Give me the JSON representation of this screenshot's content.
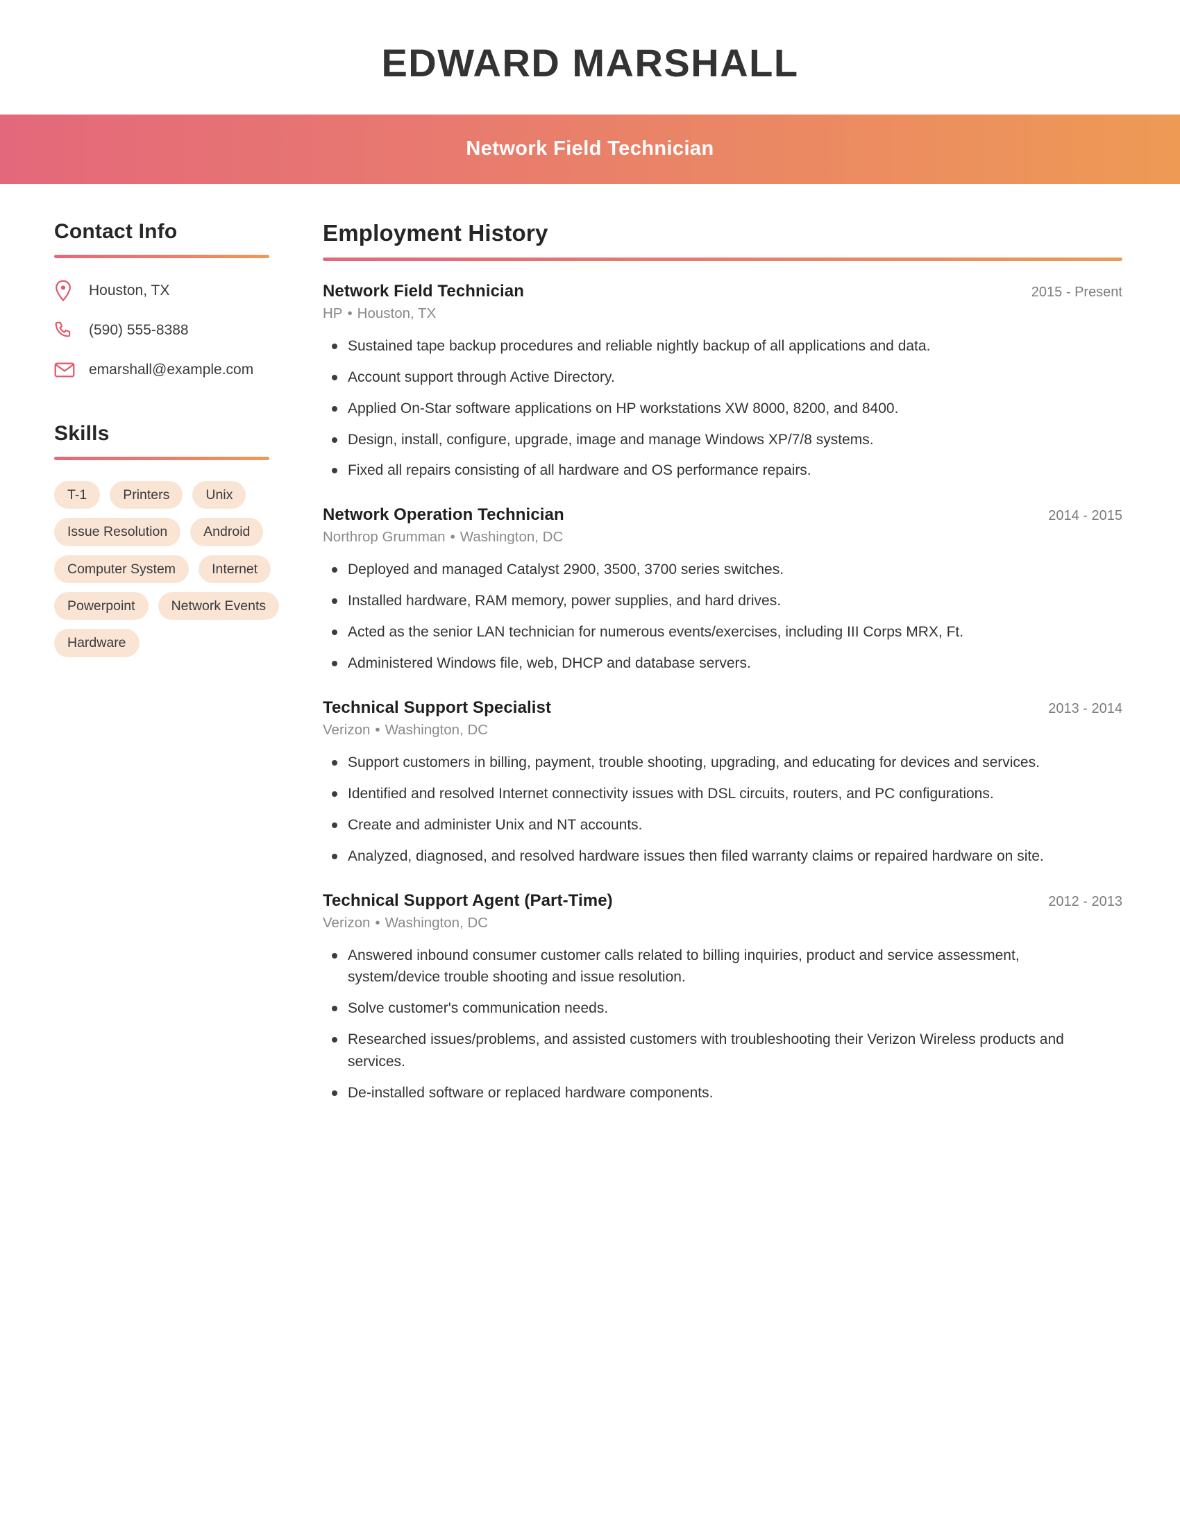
{
  "header": {
    "name": "EDWARD MARSHALL",
    "job_title": "Network Field Technician",
    "gradient_start_color": "#e4687b",
    "gradient_end_color": "#ee9a55"
  },
  "sidebar": {
    "contact": {
      "heading": "Contact Info",
      "items": [
        {
          "icon": "map-pin-icon",
          "value": "Houston, TX"
        },
        {
          "icon": "phone-icon",
          "value": "(590) 555-8388"
        },
        {
          "icon": "envelope-icon",
          "value": "emarshall@example.com"
        }
      ]
    },
    "skills": {
      "heading": "Skills",
      "pill_color": "#fae5d5",
      "items": [
        "T-1",
        "Printers",
        "Unix",
        "Issue Resolution",
        "Android",
        "Computer System",
        "Internet",
        "Powerpoint",
        "Network Events",
        "Hardware"
      ]
    }
  },
  "main": {
    "employment": {
      "heading": "Employment History",
      "jobs": [
        {
          "title": "Network Field Technician",
          "dates": "2015 - Present",
          "company": "HP",
          "location": "Houston, TX",
          "bullets": [
            "Sustained tape backup procedures and reliable nightly backup of all applications and data.",
            "Account support through Active Directory.",
            "Applied On-Star software applications on HP workstations XW 8000, 8200, and 8400.",
            "Design, install, configure, upgrade, image and manage Windows XP/7/8 systems.",
            "Fixed all repairs consisting of all hardware and OS performance repairs."
          ]
        },
        {
          "title": "Network Operation Technician",
          "dates": "2014 - 2015",
          "company": "Northrop Grumman",
          "location": "Washington, DC",
          "bullets": [
            "Deployed and managed Catalyst 2900, 3500, 3700 series switches.",
            "Installed hardware, RAM memory, power supplies, and hard drives.",
            "Acted as the senior LAN technician for numerous events/exercises, including III Corps MRX, Ft.",
            "Administered Windows file, web, DHCP and database servers."
          ]
        },
        {
          "title": "Technical Support Specialist",
          "dates": "2013 - 2014",
          "company": "Verizon",
          "location": "Washington, DC",
          "bullets": [
            "Support customers in billing, payment, trouble shooting, upgrading, and educating for devices and services.",
            "Identified and resolved Internet connectivity issues with DSL circuits, routers, and PC configurations.",
            "Create and administer Unix and NT accounts.",
            "Analyzed, diagnosed, and resolved hardware issues then filed warranty claims or repaired hardware on site."
          ]
        },
        {
          "title": "Technical Support Agent (Part-Time)",
          "dates": "2012 - 2013",
          "company": "Verizon",
          "location": "Washington, DC",
          "bullets": [
            "Answered inbound consumer customer calls related to billing inquiries, product and service assessment, system/device trouble shooting and issue resolution.",
            "Solve customer's communication needs.",
            "Researched issues/problems, and assisted customers with troubleshooting their Verizon Wireless products and services.",
            "De-installed software or replaced hardware components."
          ]
        }
      ],
      "separator": "•"
    }
  }
}
